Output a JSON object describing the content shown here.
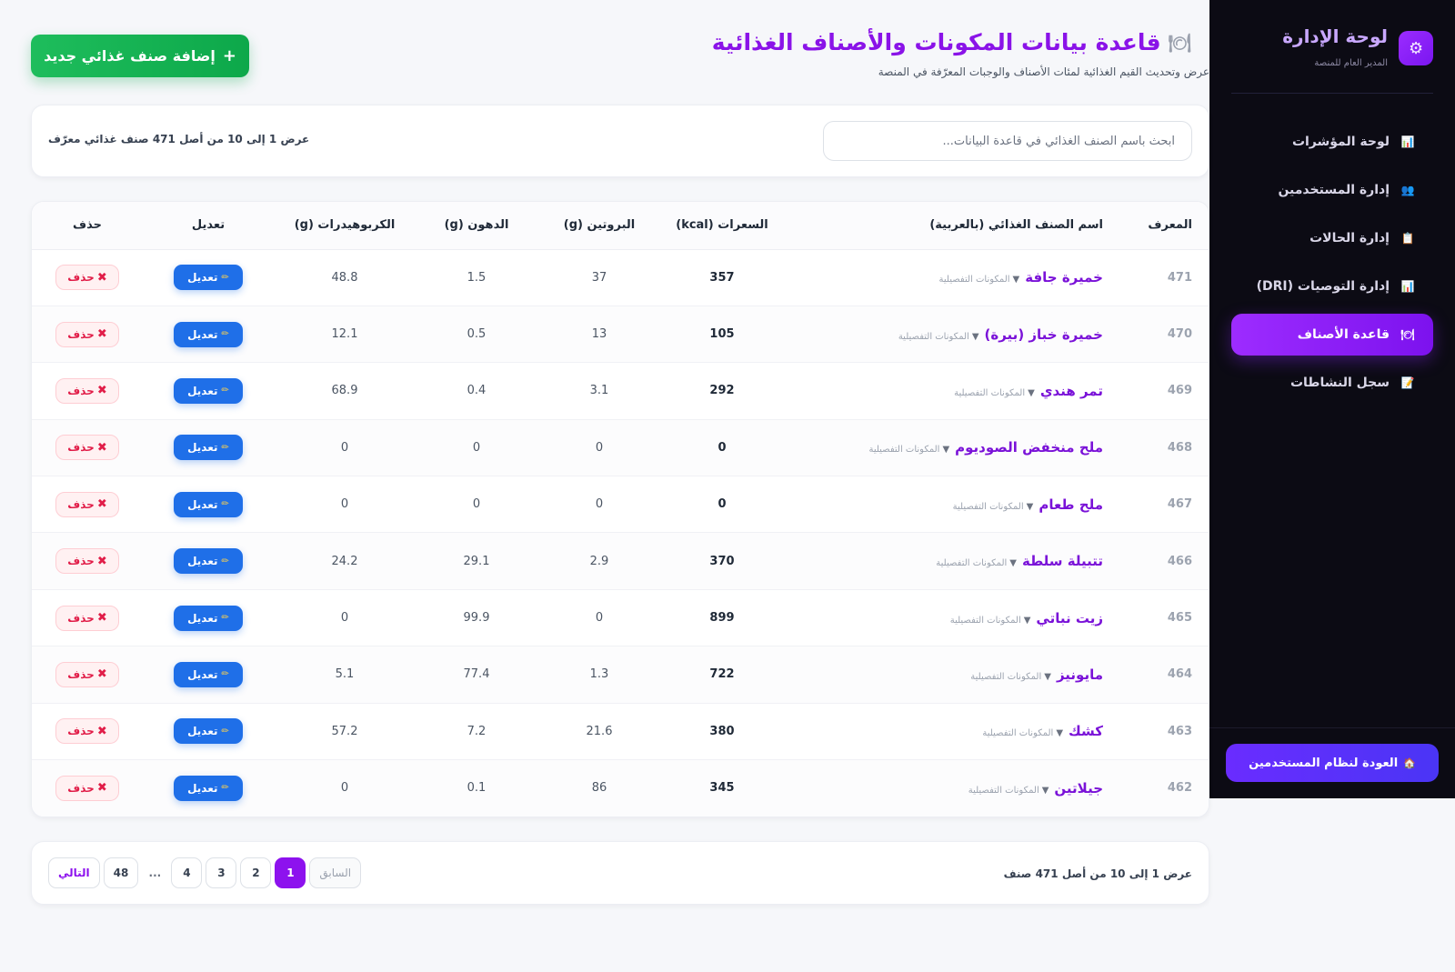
{
  "sidebar": {
    "brand_title": "لوحة الإدارة",
    "brand_subtitle": "المدير العام للمنصة",
    "brand_icon": "gear-icon",
    "items": [
      {
        "label": "لوحة المؤشرات",
        "icon": "bar-chart-icon",
        "active": false
      },
      {
        "label": "إدارة المستخدمين",
        "icon": "users-icon",
        "active": false
      },
      {
        "label": "إدارة الحالات",
        "icon": "clipboard-icon",
        "active": false
      },
      {
        "label": "إدارة التوصيات (DRI)",
        "icon": "bar-chart-icon",
        "active": false
      },
      {
        "label": "قاعدة الأصناف",
        "icon": "plate-icon",
        "active": true
      },
      {
        "label": "سجل النشاطات",
        "icon": "memo-icon",
        "active": false
      }
    ],
    "back_button": "العودة لنظام المستخدمين",
    "back_icon": "house-icon"
  },
  "header": {
    "title": "قاعدة بيانات المكونات والأصناف الغذائية",
    "title_icon": "plate-cutlery-icon",
    "subtitle": "عرض وتحديث القيم الغذائية لمئات الأصناف والوجبات المعرّفة في المنصة",
    "add_button": "إضافة صنف غذائي جديد"
  },
  "search": {
    "placeholder": "ابحث باسم الصنف الغذائي في قاعدة البيانات...",
    "value": "",
    "count_text": "عرض 1 إلى 10 من أصل 471 صنف غذائي معرّف"
  },
  "table": {
    "columns": {
      "id": "المعرف",
      "name": "اسم الصنف الغذائي (بالعربية)",
      "calories": "السعرات (kcal)",
      "protein": "البروتين (g)",
      "fat": "الدهون (g)",
      "carbs": "الكربوهيدرات (g)",
      "edit": "تعديل",
      "delete": "حذف"
    },
    "details_label": "المكونات التفصيلية",
    "edit_label": "تعديل",
    "delete_label": "حذف",
    "rows": [
      {
        "id": "471",
        "name": "خميرة جافة",
        "calories": "357",
        "protein": "37",
        "fat": "1.5",
        "carbs": "48.8"
      },
      {
        "id": "470",
        "name": "خميرة خباز (بيرة)",
        "calories": "105",
        "protein": "13",
        "fat": "0.5",
        "carbs": "12.1"
      },
      {
        "id": "469",
        "name": "تمر هندي",
        "calories": "292",
        "protein": "3.1",
        "fat": "0.4",
        "carbs": "68.9"
      },
      {
        "id": "468",
        "name": "ملح منخفض الصوديوم",
        "calories": "0",
        "protein": "0",
        "fat": "0",
        "carbs": "0"
      },
      {
        "id": "467",
        "name": "ملح طعام",
        "calories": "0",
        "protein": "0",
        "fat": "0",
        "carbs": "0"
      },
      {
        "id": "466",
        "name": "تتبيلة سلطة",
        "calories": "370",
        "protein": "2.9",
        "fat": "29.1",
        "carbs": "24.2"
      },
      {
        "id": "465",
        "name": "زيت نباتي",
        "calories": "899",
        "protein": "0",
        "fat": "99.9",
        "carbs": "0"
      },
      {
        "id": "464",
        "name": "مايونيز",
        "calories": "722",
        "protein": "1.3",
        "fat": "77.4",
        "carbs": "5.1"
      },
      {
        "id": "463",
        "name": "كشك",
        "calories": "380",
        "protein": "21.6",
        "fat": "7.2",
        "carbs": "57.2"
      },
      {
        "id": "462",
        "name": "جيلاتين",
        "calories": "345",
        "protein": "86",
        "fat": "0.1",
        "carbs": "0"
      }
    ]
  },
  "pagination": {
    "info": "عرض 1 إلى 10 من أصل 471 صنف",
    "prev": "السابق",
    "pages": [
      "1",
      "2",
      "3",
      "4"
    ],
    "ellipsis": "...",
    "last": "48",
    "next": "التالي",
    "current": "1"
  },
  "colors": {
    "accent": "#8d12ee",
    "sidebar_bg": "#0c0b14",
    "add_button": "#10b050",
    "edit_button": "#1f6fe8",
    "delete": "#e11d48"
  }
}
